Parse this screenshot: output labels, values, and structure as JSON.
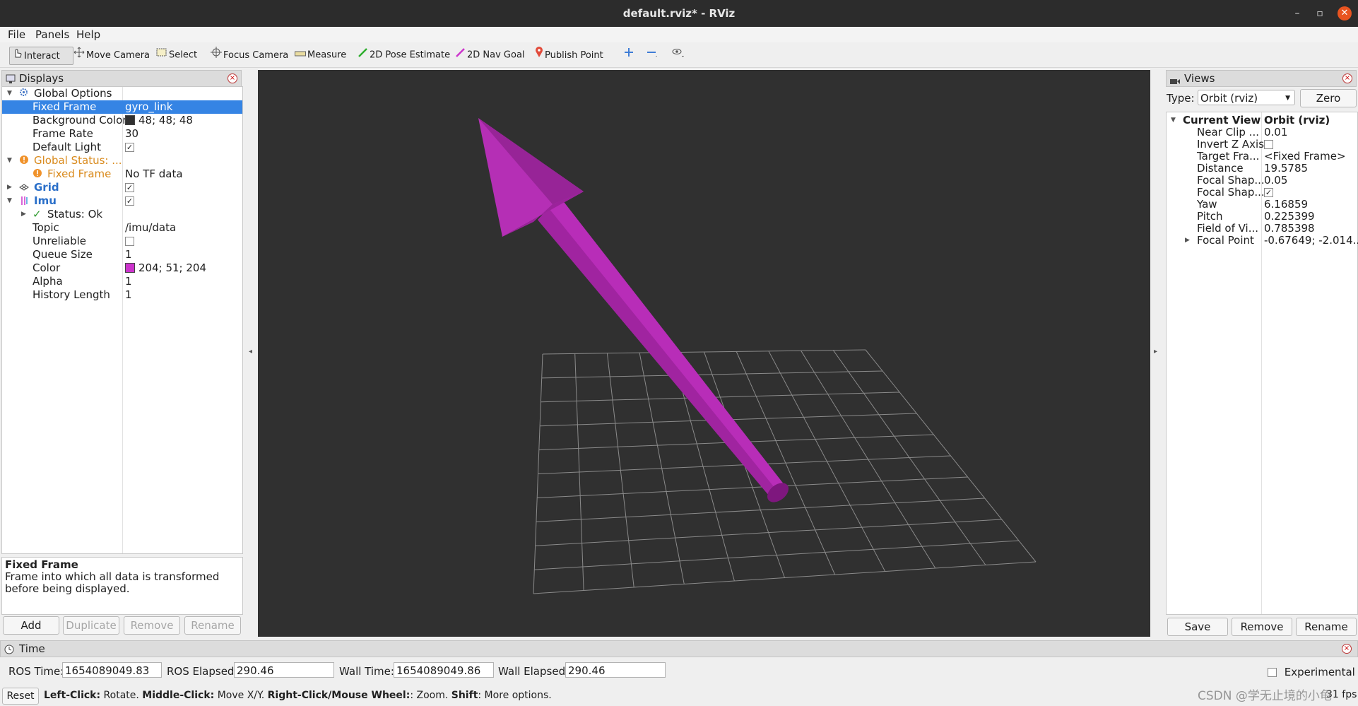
{
  "window": {
    "title": "default.rviz* - RViz",
    "minimize": "–",
    "maximize": "▫",
    "close": "✕"
  },
  "menu": {
    "file": "File",
    "panels": "Panels",
    "help": "Help"
  },
  "toolbar": {
    "interact": "Interact",
    "move_camera": "Move Camera",
    "select": "Select",
    "focus_camera": "Focus Camera",
    "measure": "Measure",
    "pose_estimate": "2D Pose Estimate",
    "nav_goal": "2D Nav Goal",
    "publish_point": "Publish Point"
  },
  "displays": {
    "title": "Displays",
    "global_options": "Global Options",
    "fixed_frame_label": "Fixed Frame",
    "fixed_frame_value": "gyro_link",
    "bg_color_label": "Background Color",
    "bg_color_value": "48; 48; 48",
    "bg_color_hex": "#303030",
    "frame_rate_label": "Frame Rate",
    "frame_rate_value": "30",
    "default_light_label": "Default Light",
    "global_status": "Global Status: ...",
    "status_fixed_frame": "Fixed Frame",
    "status_fixed_frame_value": "No TF data",
    "grid": "Grid",
    "imu": "Imu",
    "status_ok": "Status: Ok",
    "topic_label": "Topic",
    "topic_value": "/imu/data",
    "unreliable_label": "Unreliable",
    "queue_label": "Queue Size",
    "queue_value": "1",
    "color_label": "Color",
    "color_value": "204; 51; 204",
    "color_hex": "#cc33cc",
    "alpha_label": "Alpha",
    "alpha_value": "1",
    "history_label": "History Length",
    "history_value": "1",
    "help_title": "Fixed Frame",
    "help_text": "Frame into which all data is transformed before being displayed.",
    "add": "Add",
    "duplicate": "Duplicate",
    "remove": "Remove",
    "rename": "Rename"
  },
  "views": {
    "title": "Views",
    "type_label": "Type:",
    "type_value": "Orbit (rviz)",
    "zero": "Zero",
    "current_view": "Current View",
    "current_view_value": "Orbit (rviz)",
    "near_clip": "Near Clip ...",
    "near_clip_value": "0.01",
    "invert_z": "Invert Z Axis",
    "target_frame": "Target Fra...",
    "target_frame_value": "<Fixed Frame>",
    "distance": "Distance",
    "distance_value": "19.5785",
    "focal_shape_size": "Focal Shap...",
    "focal_shape_size_value": "0.05",
    "focal_shape_fixed": "Focal Shap...",
    "yaw": "Yaw",
    "yaw_value": "6.16859",
    "pitch": "Pitch",
    "pitch_value": "0.225399",
    "fov": "Field of Vi...",
    "fov_value": "0.785398",
    "focal_point": "Focal Point",
    "focal_point_value": "-0.67649; -2.014...",
    "save": "Save",
    "remove": "Remove",
    "rename": "Rename"
  },
  "time": {
    "title": "Time",
    "ros_time_label": "ROS Time:",
    "ros_time_value": "1654089049.83",
    "ros_elapsed_label": "ROS Elapsed:",
    "ros_elapsed_value": "290.46",
    "wall_time_label": "Wall Time:",
    "wall_time_value": "1654089049.86",
    "wall_elapsed_label": "Wall Elapsed:",
    "wall_elapsed_value": "290.46",
    "experimental": "Experimental"
  },
  "statusbar": {
    "reset": "Reset",
    "left_click": "Left-Click:",
    "left_click_desc": " Rotate. ",
    "middle_click": "Middle-Click:",
    "middle_click_desc": " Move X/Y. ",
    "right_click": "Right-Click/Mouse Wheel:",
    "right_click_desc": ": Zoom. ",
    "shift": "Shift",
    "shift_desc": ": More options.",
    "fps": "31 fps",
    "watermark": "CSDN @学无止境的小龟"
  },
  "colors": {
    "accent": "#3584e4",
    "warning": "#e6912c",
    "imu_arrow": "#cc33cc"
  }
}
